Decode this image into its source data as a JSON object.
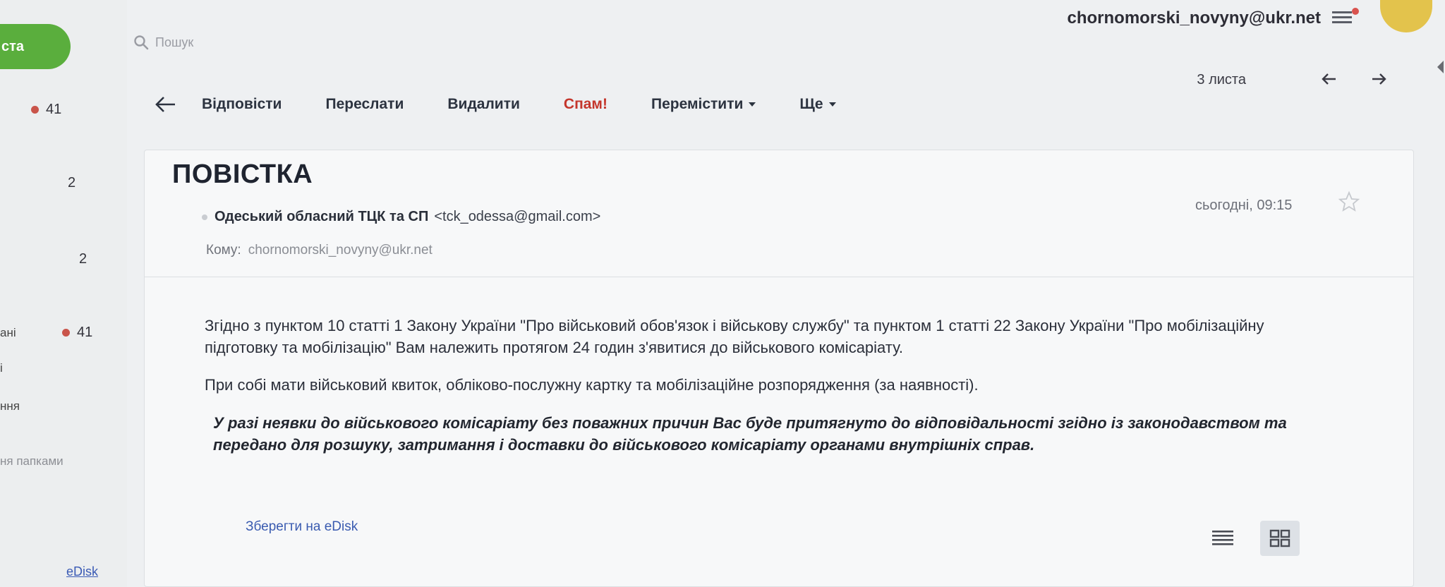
{
  "sidebar": {
    "compose_label": "ста",
    "counts": [
      {
        "value": "41",
        "has_dot": true
      },
      {
        "value": "2",
        "has_dot": false
      },
      {
        "value": "2",
        "has_dot": false
      },
      {
        "value": "41",
        "has_dot": true
      }
    ],
    "fragments": [
      "ані",
      "і",
      "ння",
      "ня папками"
    ],
    "edisk_link": "eDisk"
  },
  "search": {
    "placeholder": "Пошук"
  },
  "header": {
    "account_email": "chornomorski_novyny@ukr.net"
  },
  "toolbar": {
    "reply": "Відповісти",
    "forward": "Переслати",
    "delete": "Видалити",
    "spam": "Спам!",
    "move": "Перемістити",
    "more": "Ще",
    "count": "3 листа"
  },
  "message": {
    "subject": "ПОВІСТКА",
    "from_name": "Одеський обласний ТЦК та СП",
    "from_email": "<tck_odessa@gmail.com>",
    "date": "сьогодні, 09:15",
    "to_label": "Кому:",
    "to_value": "chornomorski_novyny@ukr.net",
    "paragraph1": "Згідно з пунктом 10 статті 1 Закону України \"Про військовий обов'язок і військову службу\" та пунктом 1 статті 22 Закону України \"Про мобілізаційну підготовку та мобілізацію\" Вам належить протягом 24 годин з'явитися до військового комісаріату.",
    "paragraph2": "При собі мати військовий квиток, обліково-послужну картку та мобілізаційне розпорядження (за наявності).",
    "paragraph3": "У разі неявки до військового комісаріату без поважних причин Вас буде притягнуто до відповідальності згідно із законодавством та передано для розшуку, затримання і доставки до військового комісаріату органами внутрішніх справ.",
    "save_to_edisk": "Зберегти на eDisk"
  },
  "colors": {
    "accent_green": "#5aae3d",
    "spam_red": "#c4362c",
    "link_blue": "#3a5bb0"
  }
}
